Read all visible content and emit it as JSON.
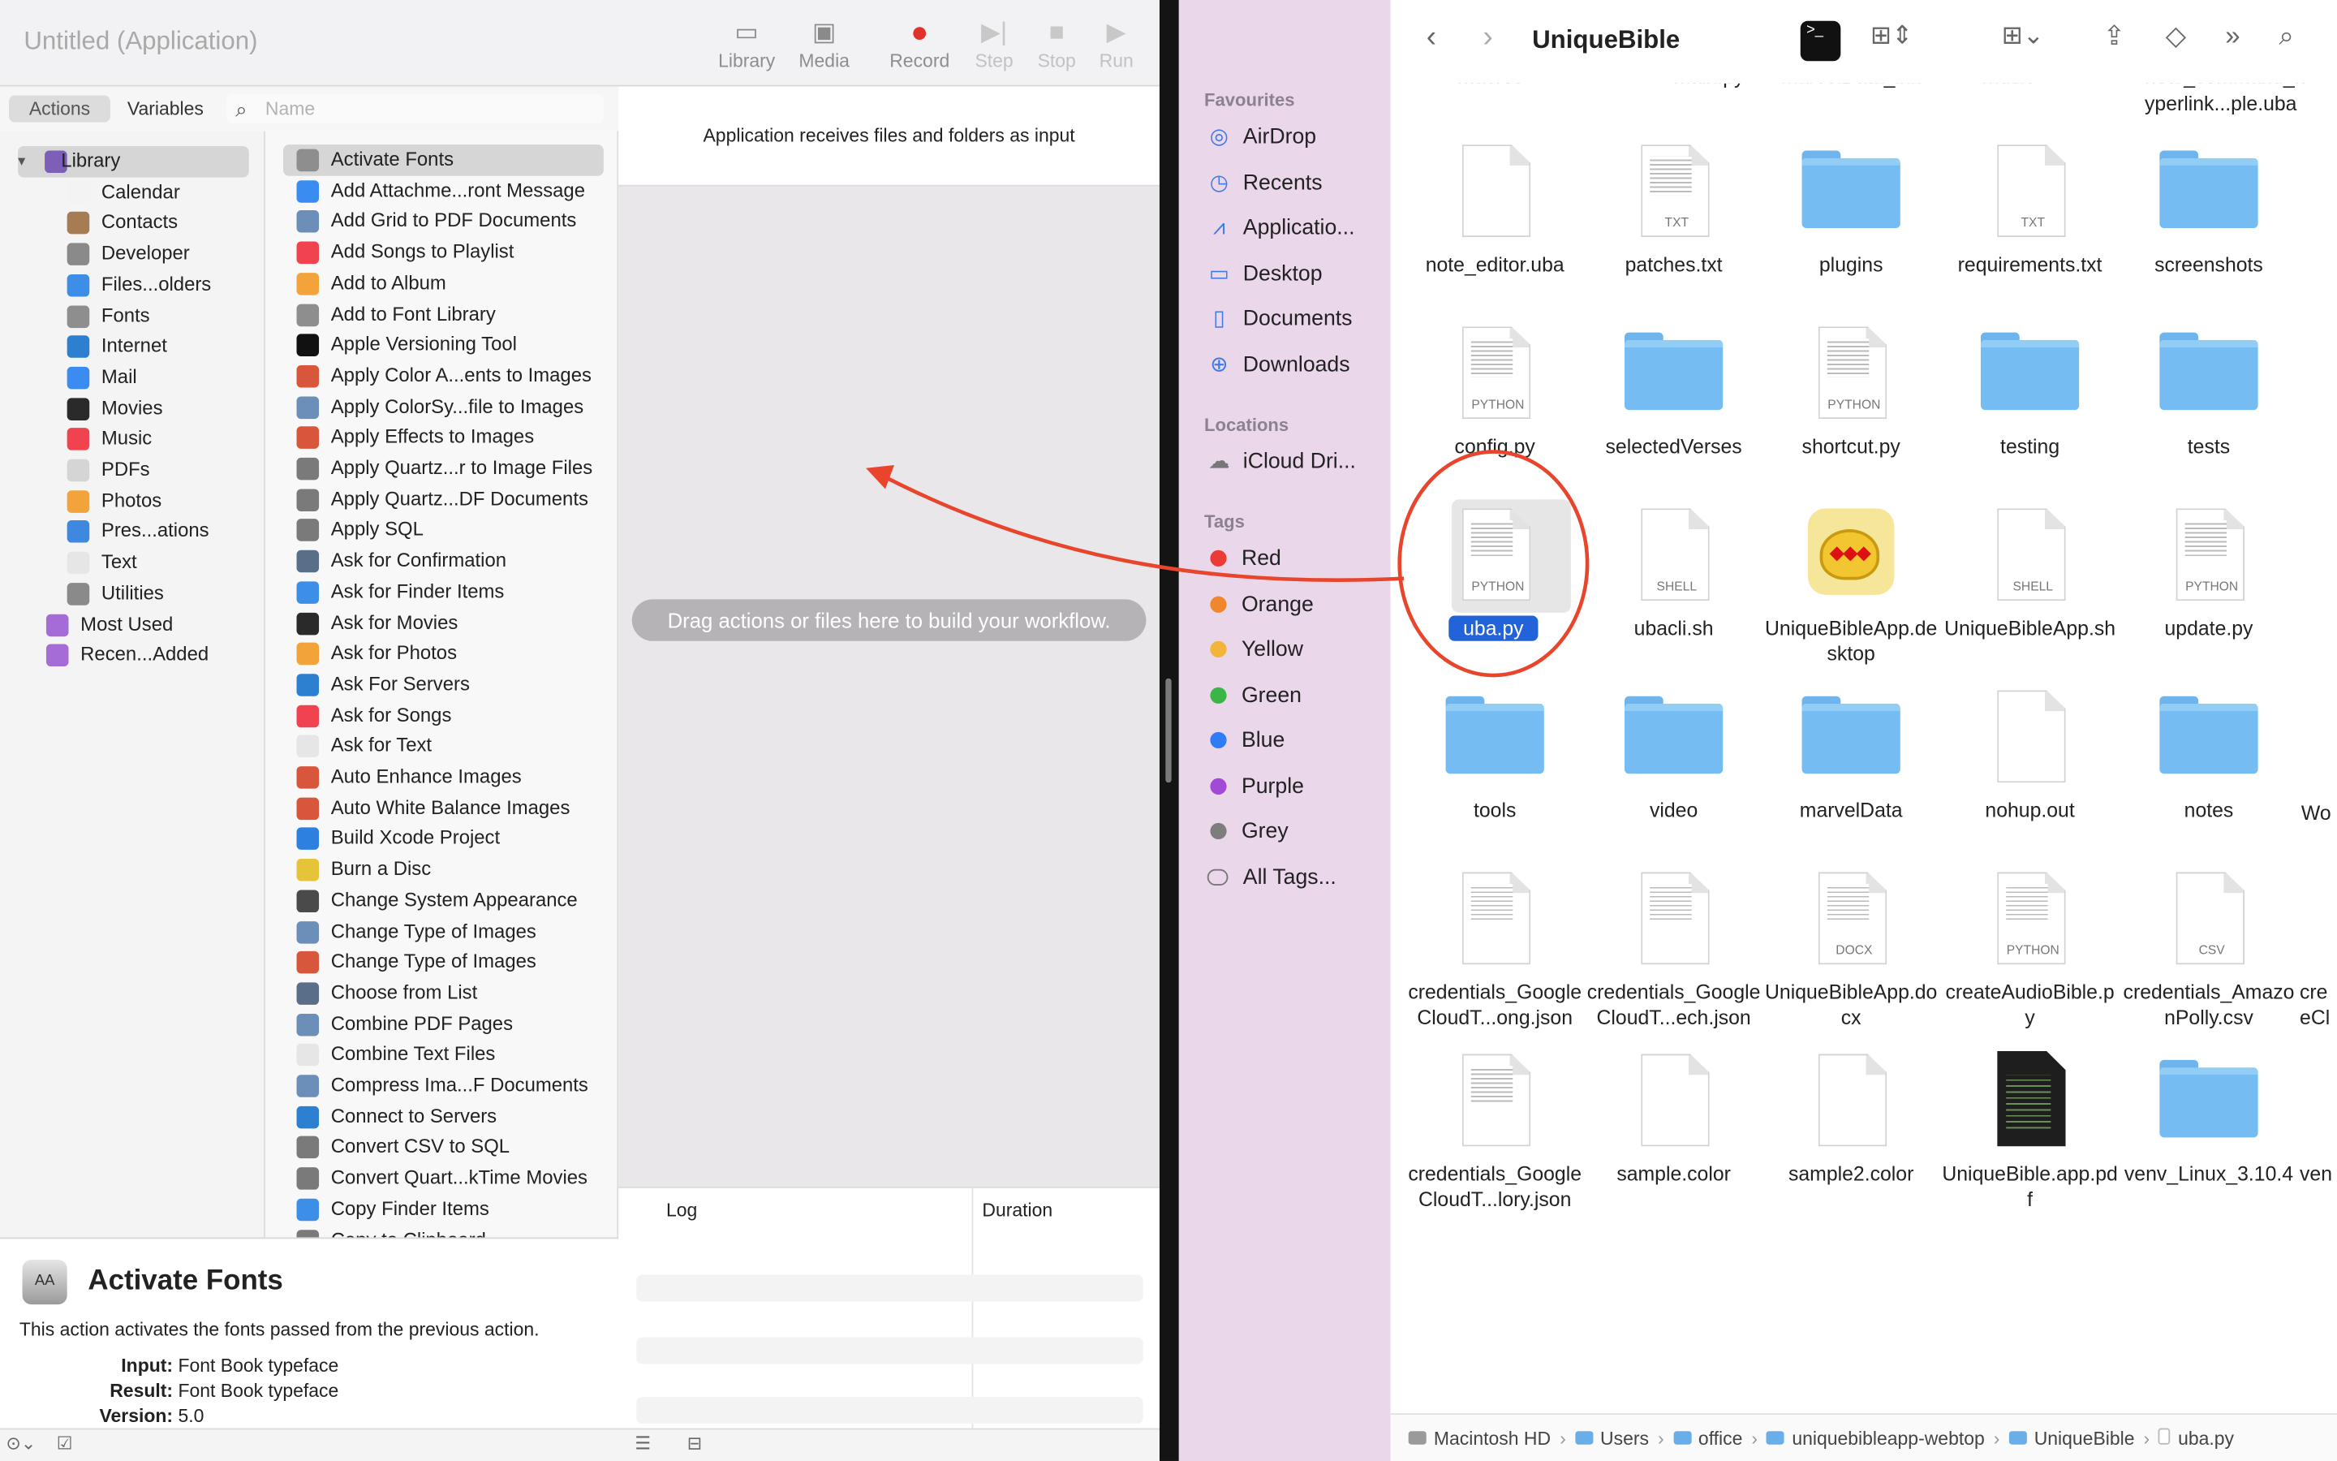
{
  "automator": {
    "window_title": "Untitled (Application)",
    "toolbar": {
      "library": "Library",
      "media": "Media",
      "record": "Record",
      "step": "Step",
      "stop": "Stop",
      "run": "Run"
    },
    "tabs": {
      "actions": "Actions",
      "variables": "Variables"
    },
    "search_placeholder": "Name",
    "library_items": [
      {
        "label": "Library",
        "icon": "library-icon",
        "color": "#7d5fb8"
      },
      {
        "label": "Calendar",
        "icon": "calendar-icon",
        "color": "#f3f3f3"
      },
      {
        "label": "Contacts",
        "icon": "contacts-icon",
        "color": "#a67c52"
      },
      {
        "label": "Developer",
        "icon": "developer-icon",
        "color": "#8a8a8a"
      },
      {
        "label": "Files...olders",
        "icon": "finder-icon",
        "color": "#3d8ee6"
      },
      {
        "label": "Fonts",
        "icon": "fonts-icon",
        "color": "#8e8e8e"
      },
      {
        "label": "Internet",
        "icon": "internet-icon",
        "color": "#2d7fcf"
      },
      {
        "label": "Mail",
        "icon": "mail-icon",
        "color": "#3b8cf0"
      },
      {
        "label": "Movies",
        "icon": "movies-icon",
        "color": "#2a2a2a"
      },
      {
        "label": "Music",
        "icon": "music-icon",
        "color": "#f0434f"
      },
      {
        "label": "PDFs",
        "icon": "pdfs-icon",
        "color": "#d5d5d5"
      },
      {
        "label": "Photos",
        "icon": "photos-icon",
        "color": "#f2a33a"
      },
      {
        "label": "Pres...ations",
        "icon": "presentations-icon",
        "color": "#3e88e0"
      },
      {
        "label": "Text",
        "icon": "text-icon",
        "color": "#e6e6e6"
      },
      {
        "label": "Utilities",
        "icon": "utilities-icon",
        "color": "#8a8a8a"
      },
      {
        "label": "Most Used",
        "icon": "most-used-folder-icon",
        "color": "#a56bd6"
      },
      {
        "label": "Recen...Added",
        "icon": "recently-added-folder-icon",
        "color": "#a56bd6"
      }
    ],
    "actions": [
      {
        "label": "Activate Fonts",
        "icon": "fonts-icon",
        "color": "#8e8e8e"
      },
      {
        "label": "Add Attachme...ront Message",
        "icon": "mail-icon",
        "color": "#3b8cf0"
      },
      {
        "label": "Add Grid to PDF Documents",
        "icon": "preview-icon",
        "color": "#6b8fb8"
      },
      {
        "label": "Add Songs to Playlist",
        "icon": "music-icon",
        "color": "#f0434f"
      },
      {
        "label": "Add to Album",
        "icon": "photos-icon",
        "color": "#f2a33a"
      },
      {
        "label": "Add to Font Library",
        "icon": "fonts-icon",
        "color": "#8e8e8e"
      },
      {
        "label": "Apple Versioning Tool",
        "icon": "terminal-icon",
        "color": "#111111"
      },
      {
        "label": "Apply Color A...ents to Images",
        "icon": "image-effects-icon",
        "color": "#d8573c"
      },
      {
        "label": "Apply ColorSy...file to Images",
        "icon": "preview-icon",
        "color": "#6b8fb8"
      },
      {
        "label": "Apply Effects to Images",
        "icon": "image-effects-icon",
        "color": "#d8573c"
      },
      {
        "label": "Apply Quartz...r to Image Files",
        "icon": "tools-icon",
        "color": "#7a7a7a"
      },
      {
        "label": "Apply Quartz...DF Documents",
        "icon": "tools-icon",
        "color": "#7a7a7a"
      },
      {
        "label": "Apply SQL",
        "icon": "tools-icon",
        "color": "#7a7a7a"
      },
      {
        "label": "Ask for Confirmation",
        "icon": "automator-icon",
        "color": "#5a6e8a"
      },
      {
        "label": "Ask for Finder Items",
        "icon": "finder-icon",
        "color": "#3d8ee6"
      },
      {
        "label": "Ask for Movies",
        "icon": "quicktime-icon",
        "color": "#2a2a2a"
      },
      {
        "label": "Ask for Photos",
        "icon": "photos-icon",
        "color": "#f2a33a"
      },
      {
        "label": "Ask For Servers",
        "icon": "internet-icon",
        "color": "#2d7fcf"
      },
      {
        "label": "Ask for Songs",
        "icon": "music-icon",
        "color": "#f0434f"
      },
      {
        "label": "Ask for Text",
        "icon": "text-icon",
        "color": "#e6e6e6"
      },
      {
        "label": "Auto Enhance Images",
        "icon": "image-effects-icon",
        "color": "#d8573c"
      },
      {
        "label": "Auto White Balance Images",
        "icon": "image-effects-icon",
        "color": "#d8573c"
      },
      {
        "label": "Build Xcode Project",
        "icon": "xcode-icon",
        "color": "#2d7fe0"
      },
      {
        "label": "Burn a Disc",
        "icon": "burn-icon",
        "color": "#e5c43a"
      },
      {
        "label": "Change System Appearance",
        "icon": "appearance-icon",
        "color": "#4a4a4a"
      },
      {
        "label": "Change Type of Images",
        "icon": "preview-icon",
        "color": "#6b8fb8"
      },
      {
        "label": "Change Type of Images",
        "icon": "image-effects-icon",
        "color": "#d8573c"
      },
      {
        "label": "Choose from List",
        "icon": "automator-icon",
        "color": "#5a6e8a"
      },
      {
        "label": "Combine PDF Pages",
        "icon": "preview-icon",
        "color": "#6b8fb8"
      },
      {
        "label": "Combine Text Files",
        "icon": "text-icon",
        "color": "#e6e6e6"
      },
      {
        "label": "Compress Ima...F Documents",
        "icon": "preview-icon",
        "color": "#6b8fb8"
      },
      {
        "label": "Connect to Servers",
        "icon": "internet-icon",
        "color": "#2d7fcf"
      },
      {
        "label": "Convert CSV to SQL",
        "icon": "tools-icon",
        "color": "#7a7a7a"
      },
      {
        "label": "Convert Quart...kTime Movies",
        "icon": "tools-icon",
        "color": "#7a7a7a"
      },
      {
        "label": "Copy Finder Items",
        "icon": "finder-icon",
        "color": "#3d8ee6"
      },
      {
        "label": "Copy to Clipboard",
        "icon": "tools-icon",
        "color": "#7a7a7a"
      }
    ],
    "description": {
      "title": "Activate Fonts",
      "text": "This action activates the fonts passed from the previous action.",
      "input_label": "Input:",
      "input_value": "Font Book typeface",
      "result_label": "Result:",
      "result_value": "Font Book typeface",
      "version_label": "Version:",
      "version_value": "5.0"
    },
    "workflow_header": "Application receives files and folders as input",
    "workflow_hint": "Drag actions or files here to build your workflow.",
    "log": {
      "col_log": "Log",
      "col_duration": "Duration"
    }
  },
  "finder": {
    "title": "UniqueBible",
    "sidebar": {
      "favourites_heading": "Favourites",
      "favourites": [
        {
          "label": "AirDrop",
          "icon": "airdrop-icon"
        },
        {
          "label": "Recents",
          "icon": "clock-icon"
        },
        {
          "label": "Applicatio...",
          "icon": "applications-icon"
        },
        {
          "label": "Desktop",
          "icon": "desktop-icon"
        },
        {
          "label": "Documents",
          "icon": "document-icon"
        },
        {
          "label": "Downloads",
          "icon": "download-icon"
        }
      ],
      "locations_heading": "Locations",
      "locations": [
        {
          "label": "iCloud Dri...",
          "icon": "cloud-icon"
        }
      ],
      "tags_heading": "Tags",
      "tags": [
        {
          "label": "Red",
          "color": "#ea3b36"
        },
        {
          "label": "Orange",
          "color": "#f0862d"
        },
        {
          "label": "Yellow",
          "color": "#f2b43a"
        },
        {
          "label": "Green",
          "color": "#3cb548"
        },
        {
          "label": "Blue",
          "color": "#2f7cf6"
        },
        {
          "label": "Purple",
          "color": "#a24ad6"
        },
        {
          "label": "Grey",
          "color": "#7d7d7d"
        },
        {
          "label": "All Tags...",
          "color": ""
        }
      ]
    },
    "partial_labels_top": [
      "macros",
      "main.py",
      "marvelData_init",
      "music",
      "note_command_h",
      "yperlink...ple.uba"
    ],
    "files": [
      {
        "name": "note_editor.uba",
        "kind": "doc",
        "badge": ""
      },
      {
        "name": "patches.txt",
        "kind": "doc-lines",
        "badge": "TXT"
      },
      {
        "name": "plugins",
        "kind": "folder",
        "badge": ""
      },
      {
        "name": "requirements.txt",
        "kind": "doc",
        "badge": "TXT"
      },
      {
        "name": "screenshots",
        "kind": "folder",
        "badge": ""
      },
      {
        "name": "config.py",
        "kind": "doc-lines",
        "badge": "PYTHON"
      },
      {
        "name": "selectedVerses",
        "kind": "folder",
        "badge": ""
      },
      {
        "name": "shortcut.py",
        "kind": "doc-lines",
        "badge": "PYTHON"
      },
      {
        "name": "testing",
        "kind": "folder",
        "badge": ""
      },
      {
        "name": "tests",
        "kind": "folder",
        "badge": ""
      },
      {
        "name": "uba.py",
        "kind": "doc-lines",
        "badge": "PYTHON",
        "selected": true
      },
      {
        "name": "ubacli.sh",
        "kind": "doc",
        "badge": "SHELL"
      },
      {
        "name": "UniqueBibleApp.desktop",
        "kind": "app",
        "badge": ""
      },
      {
        "name": "UniqueBibleApp.sh",
        "kind": "doc",
        "badge": "SHELL"
      },
      {
        "name": "update.py",
        "kind": "doc-lines",
        "badge": "PYTHON"
      },
      {
        "name": "tools",
        "kind": "folder",
        "badge": ""
      },
      {
        "name": "video",
        "kind": "folder",
        "badge": ""
      },
      {
        "name": "marvelData",
        "kind": "folder",
        "badge": ""
      },
      {
        "name": "nohup.out",
        "kind": "doc",
        "badge": ""
      },
      {
        "name": "notes",
        "kind": "folder",
        "badge": ""
      },
      {
        "name": "credentials_GoogleCloudT...ong.json",
        "kind": "doc-lines",
        "badge": ""
      },
      {
        "name": "credentials_GoogleCloudT...ech.json",
        "kind": "doc-lines",
        "badge": ""
      },
      {
        "name": "UniqueBibleApp.docx",
        "kind": "doc-lines",
        "badge": "DOCX"
      },
      {
        "name": "createAudioBible.py",
        "kind": "doc-lines",
        "badge": "PYTHON"
      },
      {
        "name": "credentials_AmazonPolly.csv",
        "kind": "doc",
        "badge": "CSV"
      },
      {
        "name": "credentials_GoogleCloudT...lory.json",
        "kind": "doc-lines",
        "badge": ""
      },
      {
        "name": "sample.color",
        "kind": "doc",
        "badge": ""
      },
      {
        "name": "sample2.color",
        "kind": "doc",
        "badge": ""
      },
      {
        "name": "UniqueBible.app.pdf",
        "kind": "pdf",
        "badge": ""
      },
      {
        "name": "venv_Linux_3.10.4",
        "kind": "folder",
        "badge": ""
      }
    ],
    "partial_labels_right": [
      "Wo",
      "cre",
      "eCl",
      "ven"
    ],
    "pathbar": [
      "Macintosh HD",
      "Users",
      "office",
      "uniquebibleapp-webtop",
      "UniqueBible",
      "uba.py"
    ]
  },
  "annotation": {
    "arrow_color": "#e8452c"
  }
}
